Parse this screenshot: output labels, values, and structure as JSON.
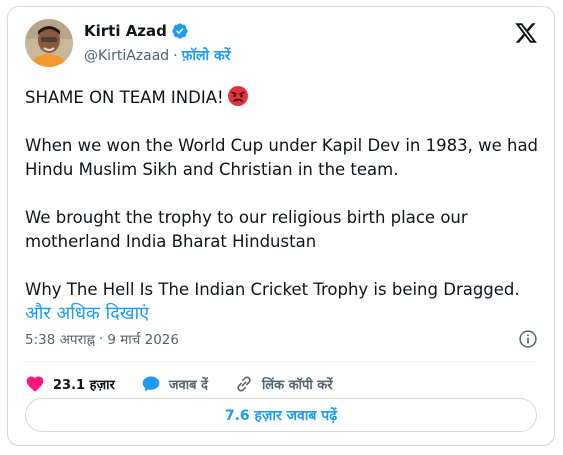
{
  "author": {
    "name": "Kirti Azad",
    "handle": "@KirtiAzaad",
    "follow_label": "फ़ॉलो करें",
    "separator": "·"
  },
  "tweet": {
    "line1": "SHAME ON TEAM INDIA!",
    "para2": "When we won the World Cup under Kapil Dev in 1983, we had Hindu Muslim Sikh and Christian in the team.",
    "para3": "We brought the trophy to our religious birth place our motherland India Bharat Hindustan",
    "para4": "Why The Hell Is The Indian Cricket Trophy is being Dragged.",
    "show_more": "और अधिक दिखाएं"
  },
  "meta": {
    "time": "5:38 अपराह्न",
    "separator": "·",
    "date": "9 मार्च 2026"
  },
  "actions": {
    "like_count": "23.1 हज़ार",
    "reply_label": "जवाब दें",
    "copy_link_label": "लिंक कॉपी करें"
  },
  "replies_button": "7.6 हज़ार जवाब पढ़ें",
  "colors": {
    "accent": "#1d9bf0",
    "like": "#f91880",
    "text": "#0f1419",
    "muted": "#536471"
  },
  "icons": [
    "verified-badge-icon",
    "x-logo-icon",
    "angry-face-emoji-icon",
    "info-icon",
    "heart-icon",
    "reply-bubble-icon",
    "link-icon"
  ]
}
